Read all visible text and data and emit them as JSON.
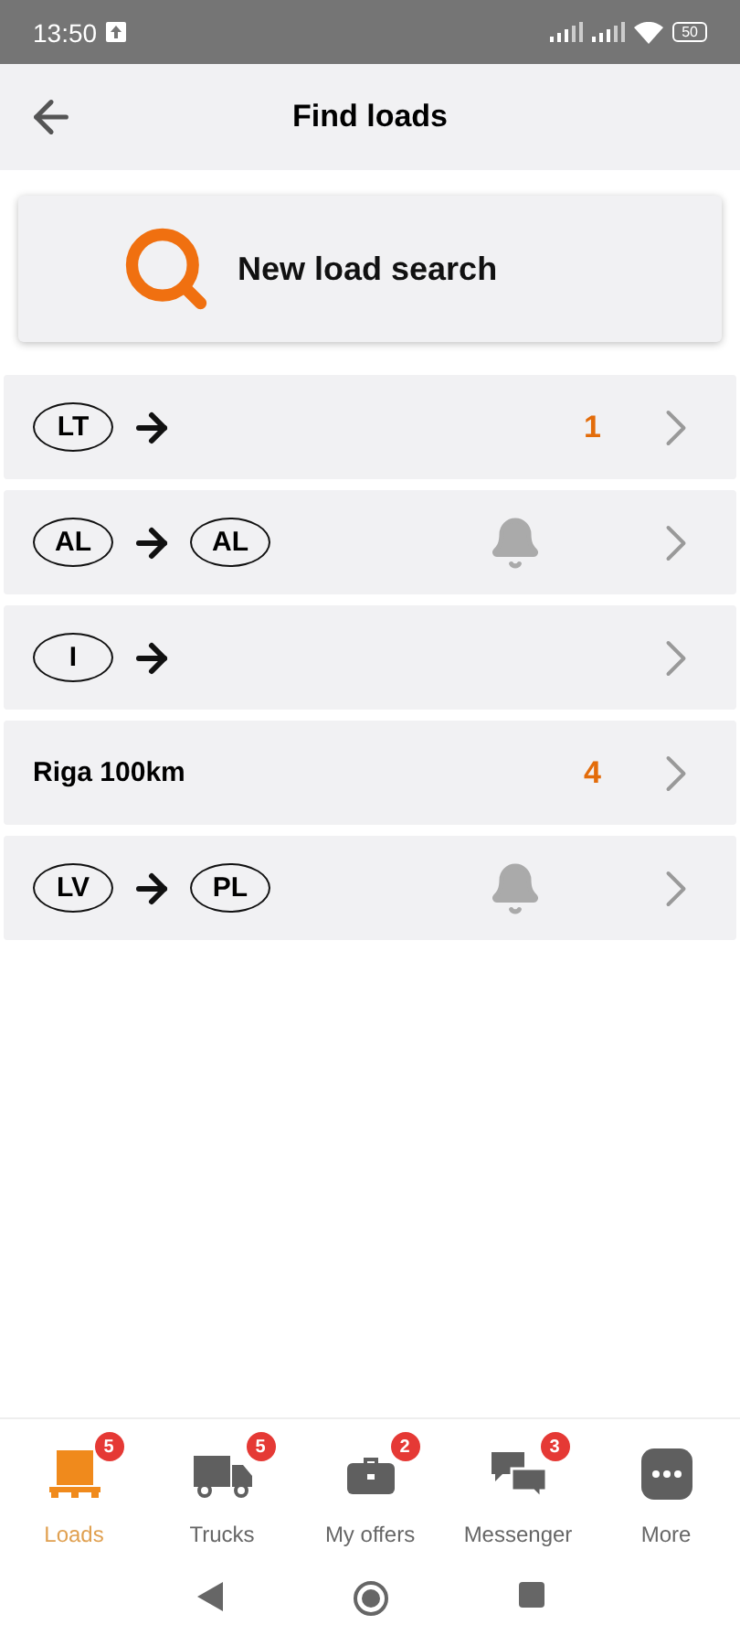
{
  "status_bar": {
    "time": "13:50",
    "battery": "50"
  },
  "header": {
    "title": "Find loads"
  },
  "new_search": {
    "label": "New load search"
  },
  "searches": [
    {
      "kind": "route",
      "from": "LT",
      "count": "1",
      "alert": false
    },
    {
      "kind": "route",
      "from": "AL",
      "to": "AL",
      "alert": true
    },
    {
      "kind": "route",
      "from": "I",
      "alert": false
    },
    {
      "kind": "place",
      "label": "Riga 100km",
      "count": "4",
      "alert": false
    },
    {
      "kind": "route",
      "from": "LV",
      "to": "PL",
      "alert": true
    }
  ],
  "bottom_nav": [
    {
      "label": "Loads",
      "badge": "5",
      "selected": true
    },
    {
      "label": "Trucks",
      "badge": "5",
      "selected": false
    },
    {
      "label": "My offers",
      "badge": "2",
      "selected": false
    },
    {
      "label": "Messenger",
      "badge": "3",
      "selected": false
    },
    {
      "label": "More",
      "selected": false
    }
  ]
}
